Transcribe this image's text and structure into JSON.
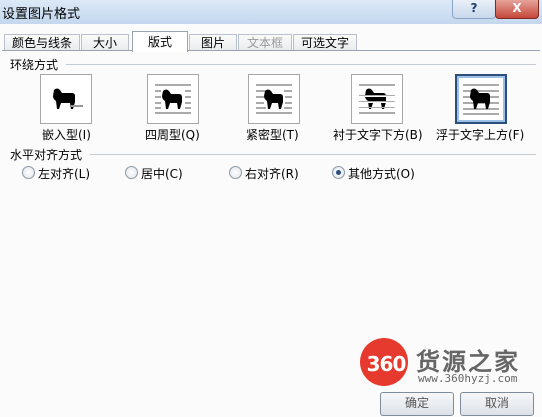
{
  "window": {
    "title": "设置图片格式",
    "help_label": "?",
    "close_label": "X"
  },
  "tabs": [
    {
      "label": "颜色与线条",
      "state": "normal"
    },
    {
      "label": "大小",
      "state": "normal"
    },
    {
      "label": "版式",
      "state": "active"
    },
    {
      "label": "图片",
      "state": "normal"
    },
    {
      "label": "文本框",
      "state": "disabled"
    },
    {
      "label": "可选文字",
      "state": "normal"
    }
  ],
  "wrap_section": {
    "label": "环绕方式",
    "options": [
      {
        "label": "嵌入型(I)",
        "icon": "wrap-inline-icon"
      },
      {
        "label": "四周型(Q)",
        "icon": "wrap-square-icon"
      },
      {
        "label": "紧密型(T)",
        "icon": "wrap-tight-icon"
      },
      {
        "label": "衬于文字下方(B)",
        "icon": "wrap-behind-icon"
      },
      {
        "label": "浮于文字上方(F)",
        "icon": "wrap-front-icon",
        "selected": true
      }
    ]
  },
  "align_section": {
    "label": "水平对齐方式",
    "options": [
      {
        "label": "左对齐(L)",
        "checked": false
      },
      {
        "label": "居中(C)",
        "checked": false
      },
      {
        "label": "右对齐(R)",
        "checked": false
      },
      {
        "label": "其他方式(O)",
        "checked": true
      }
    ]
  },
  "buttons": {
    "ok_label": "确定",
    "cancel_label": "取消"
  },
  "watermark": {
    "badge": "360",
    "brand": "货源之家",
    "url": "www.360hyzj.com"
  },
  "colors": {
    "accent": "#2c4e7a",
    "watermark_red": "#e73a2e"
  }
}
